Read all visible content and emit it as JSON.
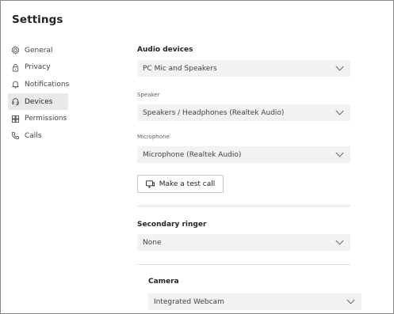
{
  "window": {
    "title": "Settings"
  },
  "nav": {
    "items": [
      {
        "label": "General",
        "icon": "gear-icon",
        "active": false
      },
      {
        "label": "Privacy",
        "icon": "lock-icon",
        "active": false
      },
      {
        "label": "Notifications",
        "icon": "bell-icon",
        "active": false
      },
      {
        "label": "Devices",
        "icon": "headset-icon",
        "active": true
      },
      {
        "label": "Permissions",
        "icon": "grid-icon",
        "active": false
      },
      {
        "label": "Calls",
        "icon": "phone-icon",
        "active": false
      }
    ]
  },
  "devices": {
    "audio_devices": {
      "title": "Audio devices",
      "value": "PC Mic and Speakers"
    },
    "speaker": {
      "label": "Speaker",
      "value": "Speakers / Headphones (Realtek Audio)"
    },
    "microphone": {
      "label": "Microphone",
      "value": "Microphone (Realtek Audio)"
    },
    "test_call_label": "Make a test call",
    "secondary_ringer": {
      "title": "Secondary ringer",
      "value": "None"
    },
    "camera": {
      "title": "Camera",
      "value": "Integrated Webcam"
    }
  },
  "colors": {
    "nav_active_bg": "#e9e9e9",
    "dropdown_bg": "#f2f2f2",
    "text": "#252423"
  }
}
